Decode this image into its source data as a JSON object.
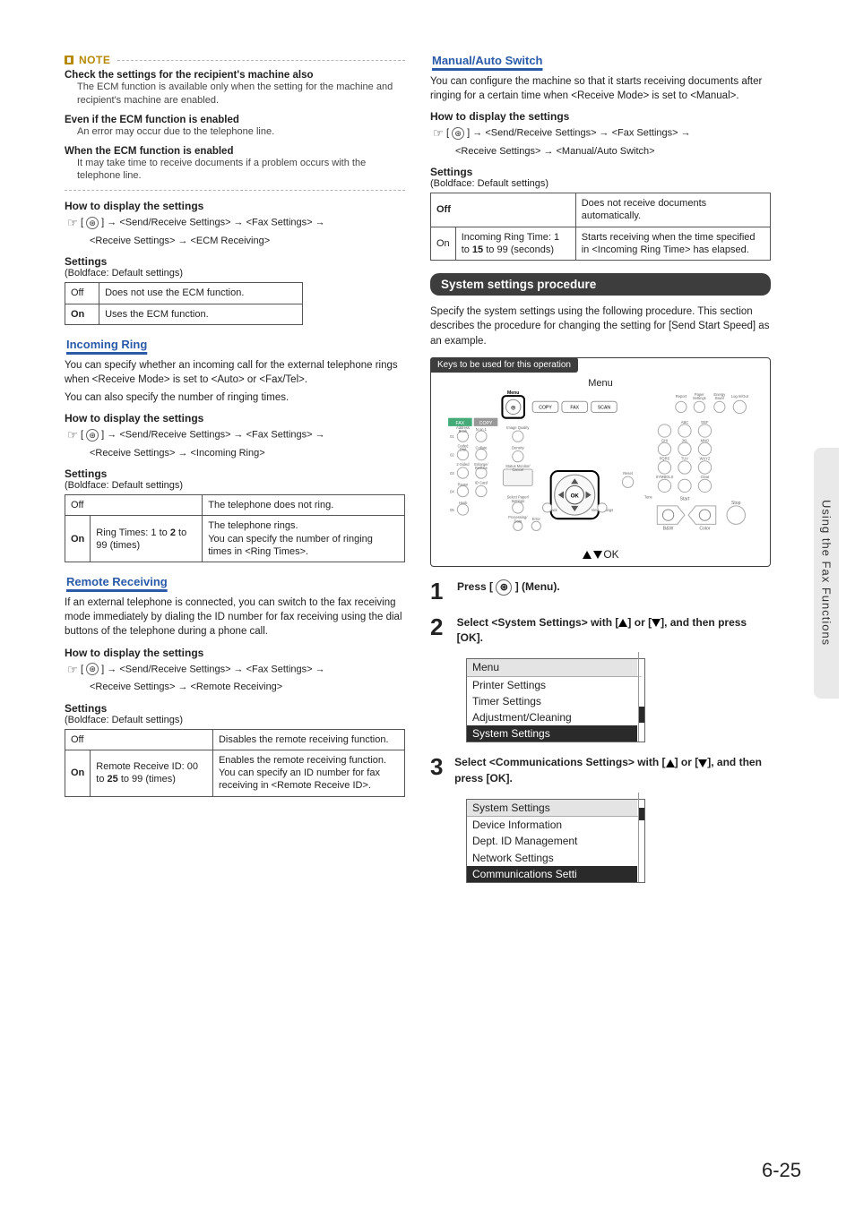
{
  "noteLabel": "NOTE",
  "notes": [
    {
      "title": "Check the settings for the recipient's machine also",
      "body": "The ECM function is available only when the setting for the machine and recipient's machine are enabled."
    },
    {
      "title": "Even if the ECM function is enabled",
      "body": "An error may occur due to the telephone line."
    },
    {
      "title": "When the ECM function is enabled",
      "body": "It may take time to receive documents if a problem occurs with the telephone line."
    }
  ],
  "howTo": "How to display the settings",
  "pathPrefix": " ] → <Send/Receive Settings> → <Fax Settings> →",
  "ecm": {
    "path2": "<Receive Settings> → <ECM Receiving>",
    "settingsLabel": "Settings",
    "boldNote": "(Boldface: Default settings)",
    "rows": [
      {
        "k": "Off",
        "bold": false,
        "v": "Does not use the ECM function."
      },
      {
        "k": "On",
        "bold": true,
        "v": "Uses the ECM function."
      }
    ]
  },
  "incoming": {
    "title": "Incoming Ring",
    "p1": "You can specify whether an incoming call for the external telephone rings when <Receive Mode> is set to <Auto> or <Fax/Tel>.",
    "p2": "You can also specify the number of ringing times.",
    "path2": "<Receive Settings> → <Incoming Ring>",
    "rows": [
      {
        "k": "Off",
        "mid": "",
        "v": "The telephone does not ring."
      },
      {
        "k": "On",
        "mid": "Ring Times: 1 to 2 to 99 (times)",
        "v": "The telephone rings.\nYou can specify the number of ringing times in <Ring Times>."
      }
    ],
    "boldMid": "2"
  },
  "remote": {
    "title": "Remote Receiving",
    "p": "If an external telephone is connected, you can switch to the fax receiving mode immediately by dialing the ID number for fax receiving using the dial buttons of the telephone during a phone call.",
    "path2": "<Receive Settings> → <Remote Receiving>",
    "rows": [
      {
        "k": "Off",
        "mid": "",
        "v": "Disables the remote receiving function."
      },
      {
        "k": "On",
        "mid": "Remote Receive ID: 00 to 25 to 99 (times)",
        "v": "Enables the remote receiving function.\nYou can specify an ID number for fax receiving in <Remote Receive ID>."
      }
    ],
    "boldMid": "25"
  },
  "manual": {
    "title": "Manual/Auto Switch",
    "p": "You can configure the machine so that it starts receiving documents after ringing for a certain time when <Receive Mode> is set to <Manual>.",
    "path2": "<Receive Settings> → <Manual/Auto Switch>",
    "rows": [
      {
        "k": "Off",
        "mid": "",
        "v": "Does not receive documents automatically."
      },
      {
        "k": "On",
        "mid": "Incoming Ring Time: 1 to 15 to 99 (seconds)",
        "v": "Starts receiving when the time specified in <Incoming Ring Time> has elapsed."
      }
    ],
    "boldMid": "15"
  },
  "system": {
    "banner": "System settings procedure",
    "p": "Specify the system settings using the following procedure. This section describes the procedure for changing the setting for [Send Start Speed] as an example.",
    "keysHead": "Keys to be used for this operation",
    "menuWord": "Menu",
    "okLine": "▲▼OK",
    "panel": {
      "modes": [
        "FAX",
        "COPY"
      ],
      "topBtns": [
        "COPY",
        "FAX",
        "SCAN"
      ],
      "leftCol": [
        "Address Book",
        "Coded Dial",
        "2-Sided",
        "Hook"
      ],
      "leftColR": [
        "N on 1",
        "Collate",
        "Enlarge/Reduce",
        "ID Card Copy"
      ],
      "midCol": [
        "Image Quality",
        "Density",
        "Status Monitor/Cancel",
        "Select Paper/Settings",
        "Processing/Data"
      ],
      "rightIcons": [
        "Report",
        "Paper Settings",
        "Energy Saver",
        "Log In/Out"
      ],
      "numTop": [
        "ABC",
        "DEF"
      ],
      "numRow2": [
        "GHI",
        "JKL",
        "MNO"
      ],
      "numRow3": [
        "PQRS",
        "TUV",
        "WXYZ"
      ],
      "numRow4": [
        "SYMBOLS",
        "Clear"
      ],
      "extra": [
        "Reset",
        "Tone",
        "Start",
        "Back",
        "View Settings",
        "Error",
        "B&W",
        "Color",
        "Stop"
      ]
    }
  },
  "steps": [
    {
      "n": "1",
      "text": "Press [  ⊛  ] (Menu)."
    },
    {
      "n": "2",
      "text": "Select <System Settings> with [▲] or [▼], and then press [OK].",
      "lcd": {
        "title": "Menu",
        "items": [
          "Printer Settings",
          "Timer Settings",
          "Adjustment/Cleaning",
          "System Settings"
        ],
        "sel": 3
      }
    },
    {
      "n": "3",
      "text": "Select <Communications Settings> with [▲] or [▼], and then press [OK].",
      "lcd": {
        "title": "System Settings",
        "items": [
          "Device Information",
          "Dept. ID Management",
          "Network Settings",
          "Communications Setti"
        ],
        "sel": 3
      }
    }
  ],
  "sideTab": "Using the Fax Functions",
  "pageNum": "6-25"
}
